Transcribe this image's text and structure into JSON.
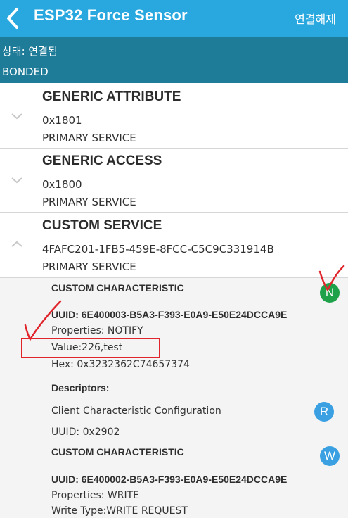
{
  "appbar": {
    "title": "ESP32 Force Sensor",
    "disconnect_label": "연결해제"
  },
  "status": {
    "state": "상태: 연결됨",
    "bond": "BONDED"
  },
  "services": [
    {
      "name": "GENERIC ATTRIBUTE",
      "uuid": "0x1801",
      "type": "PRIMARY SERVICE",
      "expanded": false
    },
    {
      "name": "GENERIC ACCESS",
      "uuid": "0x1800",
      "type": "PRIMARY SERVICE",
      "expanded": false
    },
    {
      "name": "CUSTOM SERVICE",
      "uuid": "4FAFC201-1FB5-459E-8FCC-C5C9C331914B",
      "type": "PRIMARY SERVICE",
      "expanded": true
    }
  ],
  "characteristics": [
    {
      "title": "CUSTOM CHARACTERISTIC",
      "uuid": "UUID: 6E400003-B5A3-F393-E0A9-E50E24DCCA9E",
      "properties": "Properties: NOTIFY",
      "value": "Value:226,test",
      "hex": "Hex: 0x3232362C74657374",
      "badge": "N",
      "descriptors_label": "Descriptors:",
      "descriptor_name": "Client Characteristic Configuration",
      "descriptor_uuid": "UUID: 0x2902",
      "descriptor_badge": "R"
    },
    {
      "title": "CUSTOM CHARACTERISTIC",
      "uuid": "UUID: 6E400002-B5A3-F393-E0A9-E50E24DCCA9E",
      "properties": "Properties: WRITE",
      "write_type": "Write Type:WRITE REQUEST",
      "badge": "W"
    }
  ],
  "colors": {
    "appbar": "#29a8e0",
    "status_bar": "#1f7c99",
    "badge_notify": "#1fa14a",
    "badge_other": "#3aa0e2",
    "annotation": "#e0262c"
  },
  "icons": {
    "back": "chevron-left-icon",
    "collapsed": "chevron-down-icon",
    "expanded": "chevron-up-icon"
  }
}
